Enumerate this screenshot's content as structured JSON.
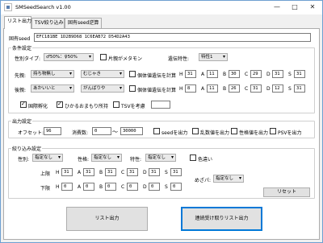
{
  "window": {
    "title": "SMSeedSearch v1.00"
  },
  "tabs": [
    "リスト出力",
    "TSV絞り込み",
    "固有seed逆算"
  ],
  "seed": {
    "label": "固有seed",
    "value": "EFC181BE 1D2B9D68 1C6EAB72 D54D2A43"
  },
  "conditions": {
    "group_title": "条件設定",
    "gender_ratio_label": "性別タイプ:",
    "gender_ratio_value": "♂50%：♀50%",
    "ditto_label": "片親がメタモン",
    "ability_label": "遺伝特性:",
    "ability_value": "特性1",
    "pre_label": "先親:",
    "pre_item": "持ち物無し",
    "pre_nature": "むじゃき",
    "calc_label": "個体値遺伝を計算",
    "pre_ivs": [
      [
        "H",
        "31"
      ],
      [
        "A",
        "11"
      ],
      [
        "B",
        "30"
      ],
      [
        "C",
        "29"
      ],
      [
        "D",
        "31"
      ],
      [
        "S",
        "31"
      ]
    ],
    "post_label": "後親:",
    "post_item": "あかいいと",
    "post_nature": "がんばりや",
    "post_ivs": [
      [
        "H",
        "8"
      ],
      [
        "A",
        "11"
      ],
      [
        "B",
        "26"
      ],
      [
        "C",
        "31"
      ],
      [
        "D",
        "12"
      ],
      [
        "S",
        "31"
      ]
    ],
    "intl_label": "国際孵化",
    "charm_label": "ひかるおまもり所持",
    "tsv_label": "TSVを考慮"
  },
  "output": {
    "group_title": "出力設定",
    "offset_label": "オフセット:",
    "offset_value": "96",
    "consume_label": "消費数:",
    "consume_from": "0",
    "tilde": "～",
    "consume_to": "30000",
    "seed_out": "seedを出力",
    "rand_out": "乱数値を出力",
    "pers_out": "性格値を出力",
    "psv_out": "PSVを出力"
  },
  "filters": {
    "group_title": "絞り込み設定",
    "gender_label": "性別:",
    "gender_value": "指定なし",
    "nature_label": "性格:",
    "nature_value": "指定なし",
    "ability_label": "特性:",
    "ability_value": "指定なし",
    "shiny_label": "色違い",
    "upper_label": "上限",
    "upper_ivs": [
      [
        "H",
        "31"
      ],
      [
        "A",
        "31"
      ],
      [
        "B",
        "31"
      ],
      [
        "C",
        "31"
      ],
      [
        "D",
        "31"
      ],
      [
        "S",
        "31"
      ]
    ],
    "lower_label": "下限",
    "lower_ivs": [
      [
        "H",
        "0"
      ],
      [
        "A",
        "0"
      ],
      [
        "B",
        "0"
      ],
      [
        "C",
        "0"
      ],
      [
        "D",
        "0"
      ],
      [
        "S",
        "0"
      ]
    ],
    "mezapa_label": "めざパ:",
    "mezapa_value": "指定なし",
    "reset_label": "リセット"
  },
  "actions": {
    "list_output": "リスト出力",
    "continuous_output": "連続受け取りリスト出力"
  }
}
